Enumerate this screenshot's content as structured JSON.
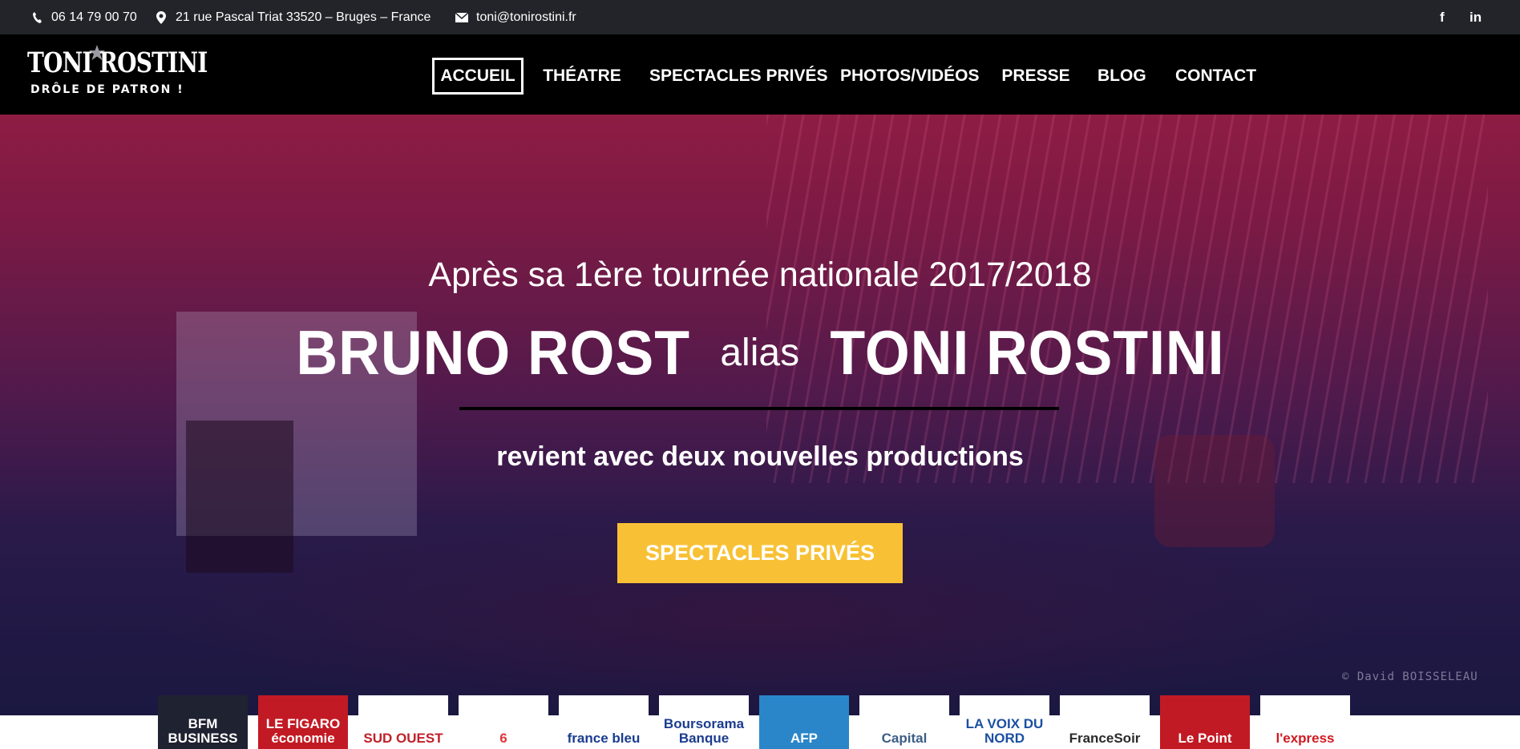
{
  "topbar": {
    "phone": "06 14 79 00 70",
    "address": "21 rue Pascal Triat 33520 – Bruges – France",
    "email": "toni@tonirostini.fr",
    "social": [
      {
        "icon": "facebook-icon",
        "label": "f"
      },
      {
        "icon": "linkedin-icon",
        "label": "in"
      }
    ]
  },
  "logo": {
    "line1": "TONI ROSTINI",
    "line2": "DRÔLE DE PATRON !"
  },
  "nav": {
    "items": [
      {
        "label": "ACCUEIL",
        "active": true
      },
      {
        "label": "THÉATRE",
        "active": false
      },
      {
        "label": "SPECTACLES PRIVÉS",
        "active": false
      },
      {
        "label": "PHOTOS/VIDÉOS",
        "active": false
      },
      {
        "label": "PRESSE",
        "active": false
      },
      {
        "label": "BLOG",
        "active": false
      },
      {
        "label": "CONTACT",
        "active": false
      }
    ]
  },
  "hero": {
    "subtitle": "Après sa 1ère tournée nationale 2017/2018",
    "name_real": "BRUNO ROST",
    "alias_word": "alias",
    "name_stage": "TONI ROSTINI",
    "tagline": "revient avec deux nouvelles productions",
    "cta_label": "SPECTACLES PRIVÉS",
    "photo_credit": "© David BOISSELEAU"
  },
  "press_logos": [
    {
      "name": "BFM BUSINESS",
      "bg": "#1f2230",
      "color": "#ffffff"
    },
    {
      "name": "LE FIGARO économie",
      "bg": "#c21a24",
      "color": "#ffffff"
    },
    {
      "name": "SUD OUEST",
      "bg": "#ffffff",
      "color": "#c0202a"
    },
    {
      "name": "6",
      "bg": "#ffffff",
      "color": "#e0353a"
    },
    {
      "name": "france bleu",
      "bg": "#ffffff",
      "color": "#1a3c8f"
    },
    {
      "name": "Boursorama Banque",
      "bg": "#ffffff",
      "color": "#1a3c8f"
    },
    {
      "name": "AFP",
      "bg": "#2a86c8",
      "color": "#ffffff"
    },
    {
      "name": "Capital",
      "bg": "#ffffff",
      "color": "#3c5d86"
    },
    {
      "name": "LA VOIX DU NORD",
      "bg": "#ffffff",
      "color": "#1b4fa1"
    },
    {
      "name": "FranceSoir",
      "bg": "#ffffff",
      "color": "#2a2a2a"
    },
    {
      "name": "Le Point",
      "bg": "#c21a24",
      "color": "#ffffff"
    },
    {
      "name": "l'express",
      "bg": "#ffffff",
      "color": "#d01a22"
    }
  ],
  "colors": {
    "topbar_bg": "#23242a",
    "header_bg": "#000000",
    "cta_bg": "#f8c135",
    "hero_top": "#8e1c43",
    "hero_bottom": "#17173f"
  }
}
